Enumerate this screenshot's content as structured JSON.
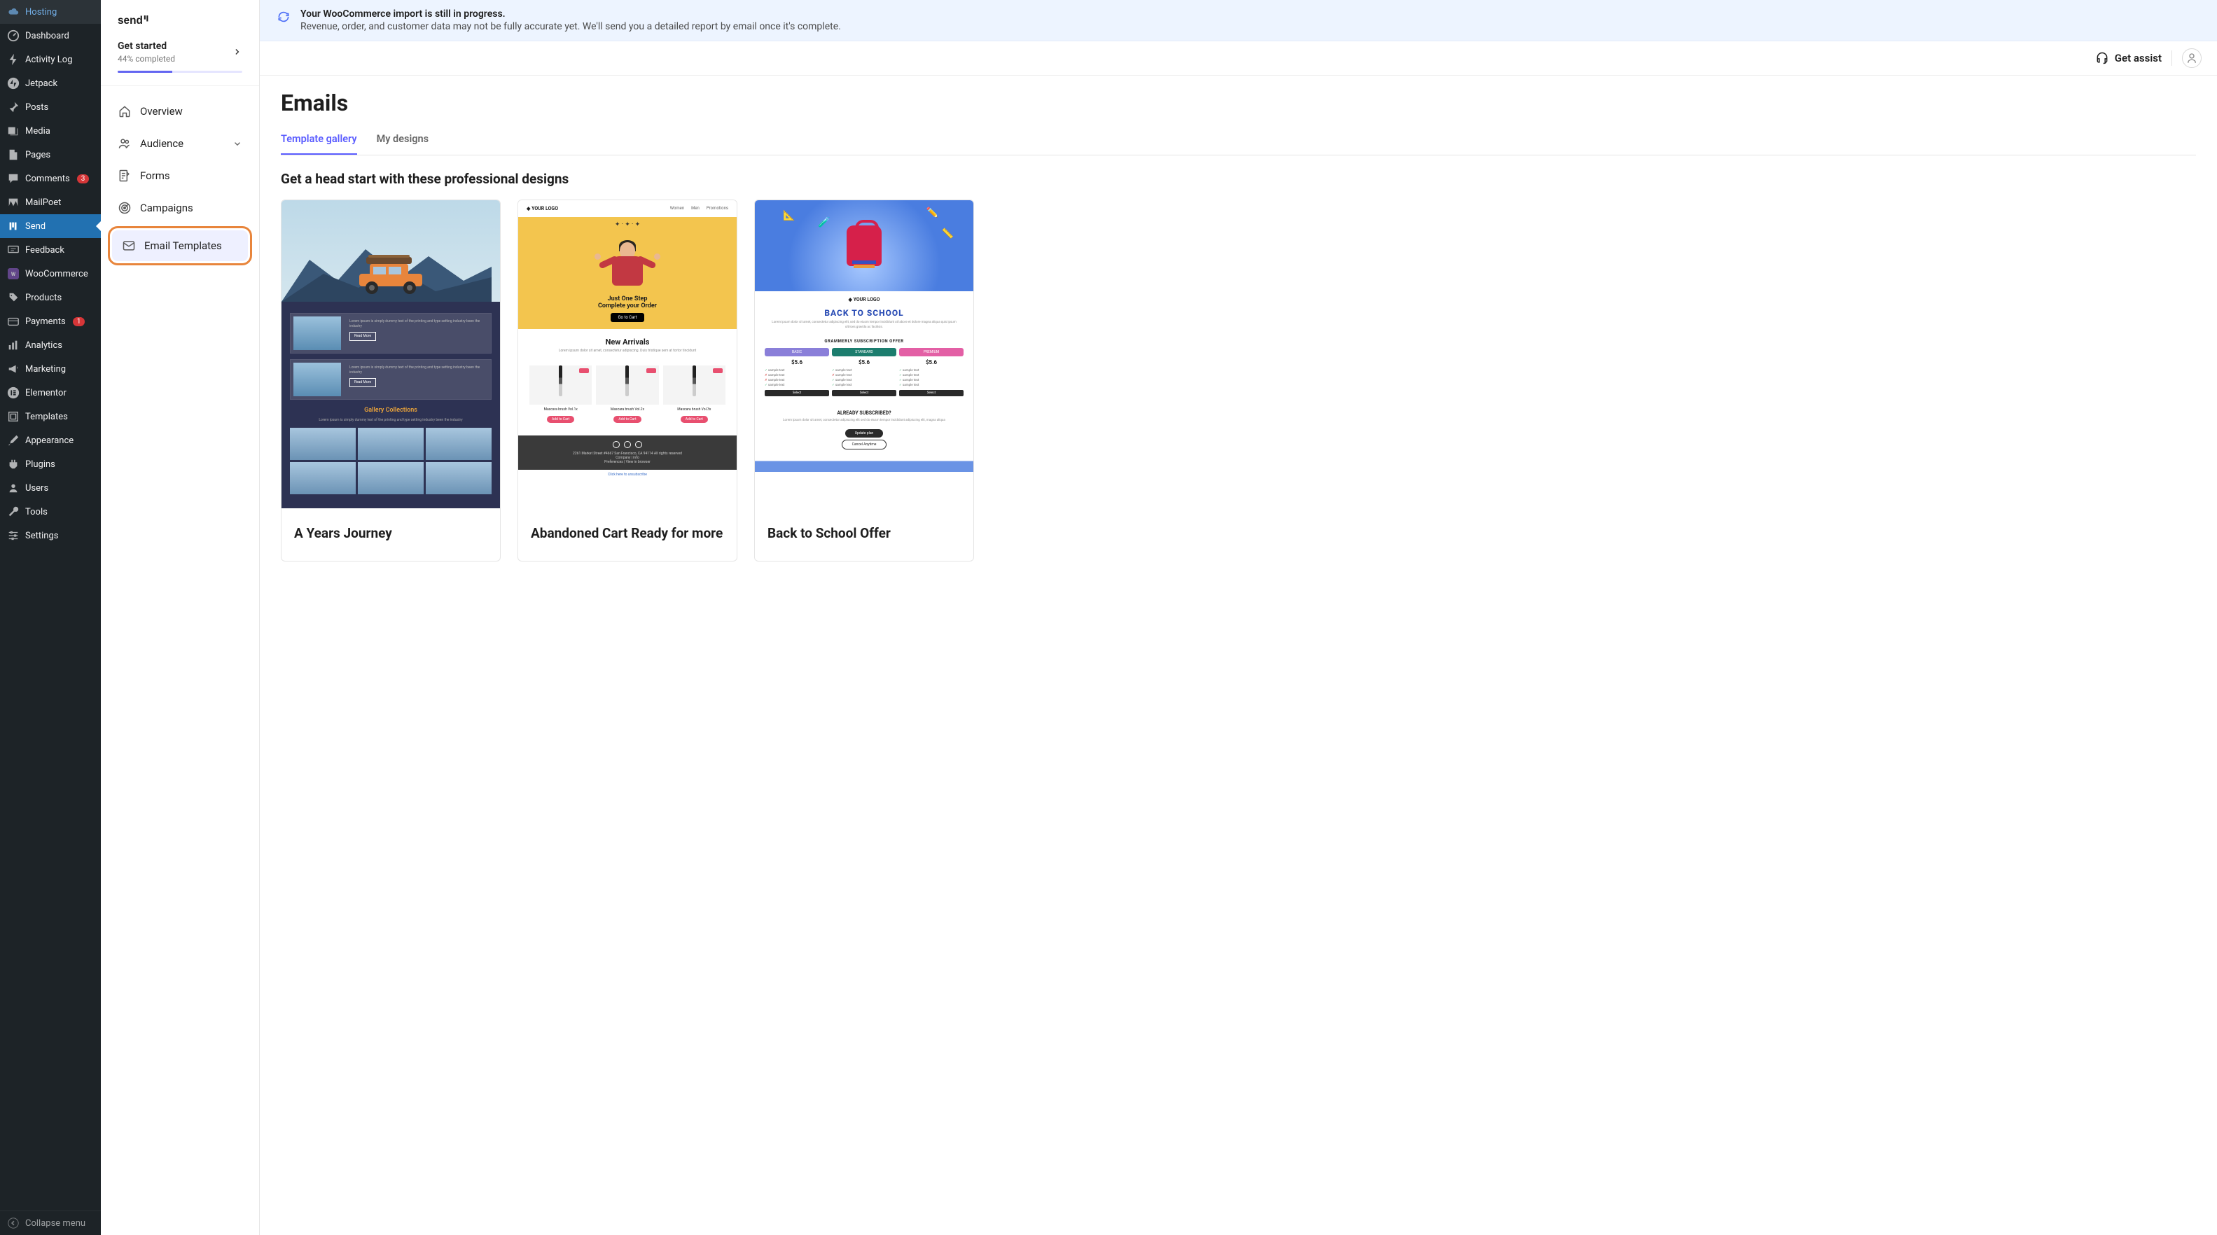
{
  "wp_sidebar": {
    "items": [
      {
        "label": "Hosting",
        "icon": "cloud"
      },
      {
        "label": "Dashboard",
        "icon": "gauge"
      },
      {
        "label": "Activity Log",
        "icon": "bolt"
      },
      {
        "label": "Jetpack",
        "icon": "jetpack"
      },
      {
        "label": "Posts",
        "icon": "pin"
      },
      {
        "label": "Media",
        "icon": "media"
      },
      {
        "label": "Pages",
        "icon": "page"
      },
      {
        "label": "Comments",
        "icon": "comment",
        "badge": "3"
      },
      {
        "label": "MailPoet",
        "icon": "mailpoet"
      },
      {
        "label": "Send",
        "icon": "send",
        "active": true
      },
      {
        "label": "Feedback",
        "icon": "feedback"
      },
      {
        "label": "WooCommerce",
        "icon": "woo"
      },
      {
        "label": "Products",
        "icon": "product"
      },
      {
        "label": "Payments",
        "icon": "payments",
        "badge": "1"
      },
      {
        "label": "Analytics",
        "icon": "analytics"
      },
      {
        "label": "Marketing",
        "icon": "marketing"
      },
      {
        "label": "Elementor",
        "icon": "elementor"
      },
      {
        "label": "Templates",
        "icon": "templates"
      },
      {
        "label": "Appearance",
        "icon": "brush"
      },
      {
        "label": "Plugins",
        "icon": "plugin"
      },
      {
        "label": "Users",
        "icon": "users"
      },
      {
        "label": "Tools",
        "icon": "wrench"
      },
      {
        "label": "Settings",
        "icon": "settings"
      }
    ],
    "collapse": "Collapse menu"
  },
  "send_sidebar": {
    "logo": "send",
    "get_started": {
      "title": "Get started",
      "subtitle": "44%  completed",
      "percent": 44
    },
    "items": [
      {
        "label": "Overview",
        "icon": "home"
      },
      {
        "label": "Audience",
        "icon": "audience",
        "expandable": true
      },
      {
        "label": "Forms",
        "icon": "forms"
      },
      {
        "label": "Campaigns",
        "icon": "campaigns"
      },
      {
        "label": "Email Templates",
        "icon": "email",
        "selected": true,
        "highlighted": true
      }
    ]
  },
  "banner": {
    "title": "Your WooCommerce import is still in progress.",
    "subtitle": "Revenue, order, and customer data may not be fully accurate yet. We'll send you a detailed report by email once it's complete."
  },
  "topbar": {
    "assist": "Get assist"
  },
  "page": {
    "title": "Emails",
    "tabs": [
      {
        "label": "Template gallery",
        "active": true
      },
      {
        "label": "My designs"
      }
    ],
    "subhead": "Get a head start with these professional designs",
    "templates": [
      {
        "title": "A Years Journey",
        "preview": {
          "gallery_title": "Gallery Collections",
          "read_more": "Read More",
          "lorem": "Lorem ipsum is simply dummy text of the printing and type setting industry been the industry"
        }
      },
      {
        "title": "Abandoned Cart Ready for more",
        "preview": {
          "logo": "YOUR LOGO",
          "nav": [
            "Women",
            "Men",
            "Promotions"
          ],
          "headline1": "Just One Step",
          "headline2": "Complete your Order",
          "cta": "Go to Cart",
          "arrivals_title": "New Arrivals",
          "arrivals_sub": "Lorem ipsum dolor sit amet, consectetur adipiscing. Duis tristique sem at tortor tincidunt",
          "products": [
            {
              "name": "Mascara brush Vol.1x",
              "btn": "Add to Cart"
            },
            {
              "name": "Mascara brush Vol.2x",
              "btn": "Add to Cart"
            },
            {
              "name": "Mascara brush Vol.3x",
              "btn": "Add to Cart"
            }
          ],
          "footer_addr": "2261 Market Street #4667 San Francisco, CA 94114 All rights reserved",
          "footer_company": "Company | info",
          "unsub": "Click here to unsubscribe",
          "view_browser": "Preferences | View in browser"
        }
      },
      {
        "title": "Back to School Offer",
        "preview": {
          "logo": "YOUR LOGO",
          "headline": "BACK TO SCHOOL",
          "sub": "Lorem ipsum dolor sit amet, consectetur adipiscing elit, sed do eiusm tempor incididunt ut labore et dolore magna aliqua quis ipsum ultrices gravida ac facilisis.",
          "offer": "GRAMMERLY SUBSCRIPTION OFFER",
          "plans": [
            {
              "name": "BASIC",
              "price": "$5.6"
            },
            {
              "name": "STANDARD",
              "price": "$5.6"
            },
            {
              "name": "PREMIUM",
              "price": "$5.6"
            }
          ],
          "feature": "sample text",
          "select": "Select",
          "already": "ALREADY SUBSCRIBED?",
          "upgrade": "Update plan",
          "cancel": "Cancel Anytime",
          "already_sub": "Lorem ipsum dolor sit amet, consectetur adipiscing elit sed do eiusm tempor incididunt adipiscing elit, magna aliqua"
        }
      }
    ]
  }
}
